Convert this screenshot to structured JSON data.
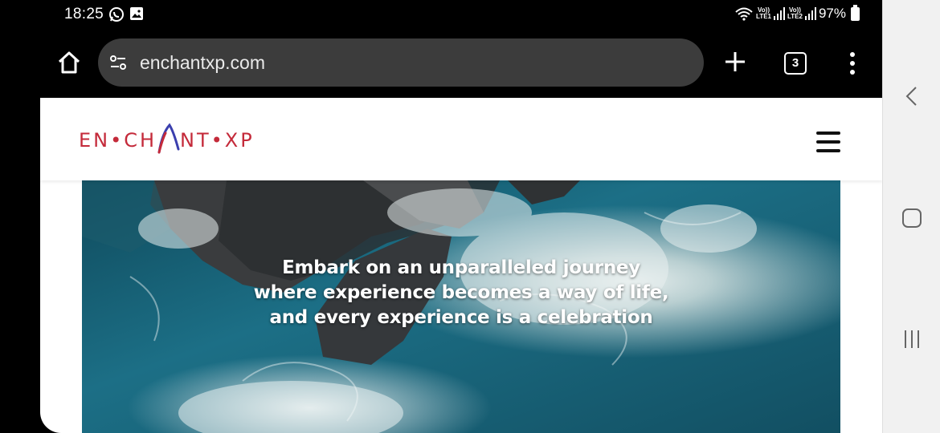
{
  "status_bar": {
    "time": "18:25",
    "notification_icons": [
      "whatsapp-icon",
      "image-icon"
    ],
    "sim1_label_top": "Vo))",
    "sim1_label_bottom": "LTE1",
    "sim2_label_top": "Vo))",
    "sim2_label_bottom": "LTE2",
    "battery_percent": "97%"
  },
  "browser": {
    "url": "enchantxp.com",
    "tab_count": "3",
    "icons": {
      "home": "home-icon",
      "site_settings": "tune-icon",
      "new_tab": "plus-icon",
      "menu": "more-vert-icon"
    }
  },
  "site": {
    "logo_text_left": "EN•CH",
    "logo_text_right": "NT•XP",
    "brand_color": "#c42a3a",
    "hero_lines": [
      "Embark on an unparalleled journey",
      "where experience becomes a way of life,",
      "and every experience is a celebration"
    ]
  },
  "system_nav": {
    "buttons": [
      "back-icon",
      "home-square-icon",
      "recents-icon"
    ]
  }
}
